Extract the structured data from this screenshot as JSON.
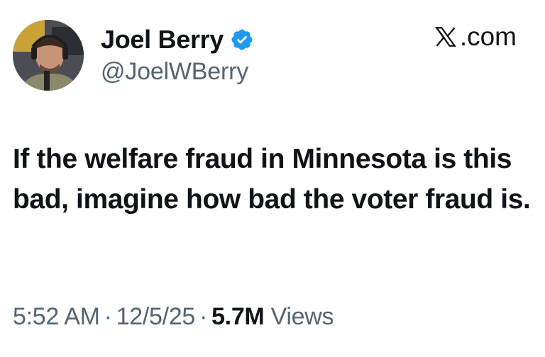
{
  "author": {
    "display_name": "Joel Berry",
    "handle": "@JoelWBerry",
    "verified": true,
    "avatar_icon": "avatar-photo"
  },
  "site": {
    "label": ".com",
    "logo_icon": "x-logo-icon"
  },
  "tweet": {
    "text": "If the welfare fraud in Minnesota is this bad, imagine how bad the voter fraud is."
  },
  "meta": {
    "time": "5:52 AM",
    "separator": "·",
    "date": "12/5/25",
    "views_count": "5.7M",
    "views_label": "Views"
  },
  "colors": {
    "text_primary": "#0f1419",
    "text_secondary": "#536471",
    "verified_blue": "#1d9bf0"
  }
}
